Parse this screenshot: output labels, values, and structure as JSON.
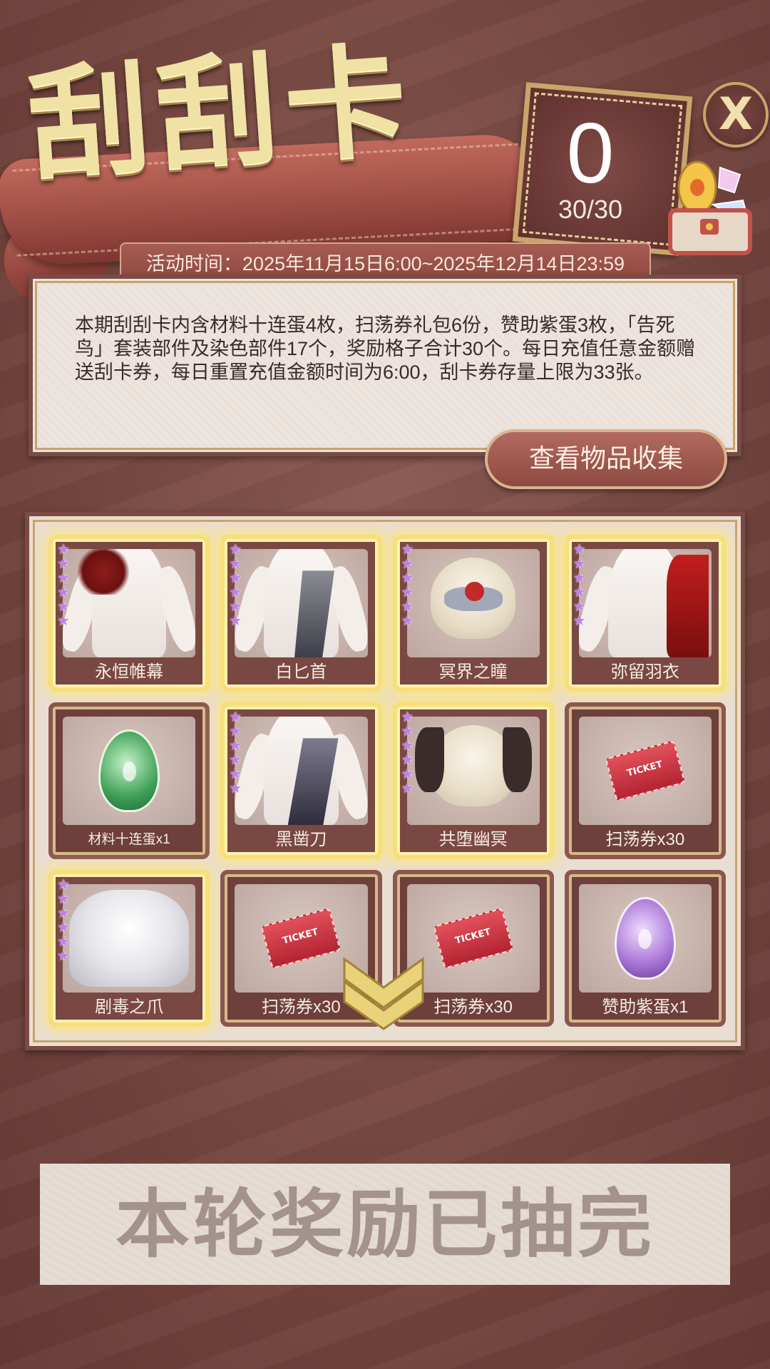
{
  "header": {
    "title": "刮刮卡",
    "counter_remaining": "0",
    "counter_total": "30/30",
    "close_label": "X",
    "activity_time": "活动时间：2025年11月15日6:00~2025年12月14日23:59"
  },
  "description": {
    "text": "本期刮刮卡内含材料十连蛋4枚，扫荡券礼包6份，赞助紫蛋3枚，「告死鸟」套装部件及染色部件17个，奖励格子合计30个。每日充值任意金额赠送刮卡券，每日重置充值金额时间为6:00，刮卡券存量上限为33张。",
    "collect_button": "查看物品收集"
  },
  "grid": {
    "items": [
      {
        "label": "永恒帷幕"
      },
      {
        "label": "白匕首"
      },
      {
        "label": "冥界之瞳"
      },
      {
        "label": "弥留羽衣"
      },
      {
        "label": "材料十连蛋x1"
      },
      {
        "label": "黑凿刀"
      },
      {
        "label": "共堕幽冥"
      },
      {
        "label": "扫荡券x30"
      },
      {
        "label": "剧毒之爪"
      },
      {
        "label": "扫荡券x30"
      },
      {
        "label": "扫荡券x30"
      },
      {
        "label": "赞助紫蛋x1"
      }
    ],
    "ticket_text": "TICKET"
  },
  "footer": {
    "status": "本轮奖励已抽完"
  },
  "colors": {
    "background": "#74463f",
    "gold": "#efe2a4",
    "star": "#c17ef0"
  }
}
